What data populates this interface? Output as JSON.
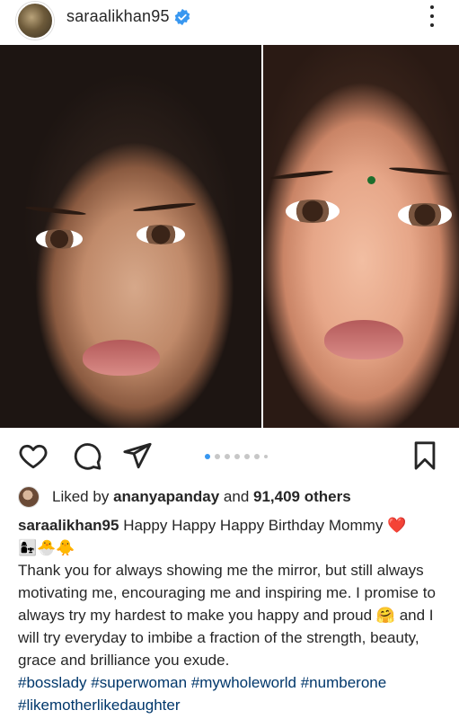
{
  "post": {
    "username": "saraalikhan95",
    "verified_icon": "verified-badge-icon",
    "more_icon": "more-options-icon"
  },
  "actions": {
    "like_icon": "heart-icon",
    "comment_icon": "comment-icon",
    "share_icon": "send-icon",
    "save_icon": "bookmark-icon",
    "carousel_total": 7,
    "carousel_active": 1
  },
  "likes": {
    "prefix": "Liked by",
    "user": "ananyapanday",
    "middle": "and",
    "count": "91,409 others"
  },
  "caption": {
    "username": "saraalikhan95",
    "line1": "Happy Happy Happy Birthday Mommy",
    "heart_emoji": "❤️",
    "emoji_line": "👩‍👧🐣🐥",
    "body": "Thank you for always showing me the mirror, but still always motivating me, encouraging me and inspiring me. I promise to always try my hardest to make you happy and proud",
    "hug_emoji": "🤗",
    "body2": "and I will try everyday to imbibe a fraction of the strength, beauty, grace and brilliance you exude.",
    "hashtags": [
      "#bosslady",
      "#superwoman",
      "#mywholeworld",
      "#numberone",
      "#likemotherlikedaughter"
    ]
  },
  "colors": {
    "text": "#262626",
    "link": "#00376b",
    "verified": "#3897f0",
    "carousel_active": "#3897f0"
  }
}
